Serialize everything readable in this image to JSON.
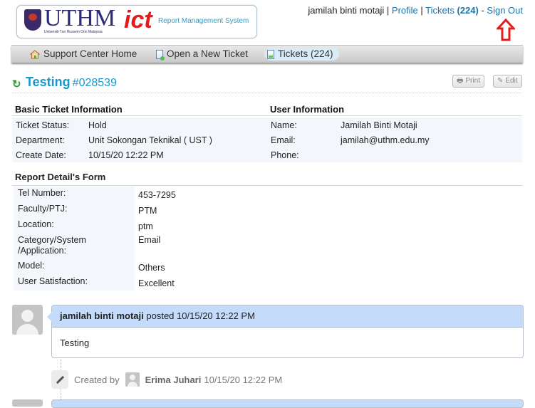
{
  "header": {
    "logo": {
      "brand": "UTHM",
      "brand_sub": "Universiti Tun Hussein Onn Malaysia",
      "ict": "ict",
      "system_name": "Report Management System"
    },
    "user_links": {
      "username": "jamilah binti motaji",
      "separator1": " | ",
      "profile": "Profile",
      "separator2": " | ",
      "tickets": "Tickets",
      "tickets_count": "(224)",
      "separator3": " - ",
      "sign_out": "Sign Out"
    },
    "annotation_arrow_color": "#e31d1d"
  },
  "nav": {
    "items": [
      {
        "label": "Support Center Home",
        "icon": "home-icon",
        "active": false
      },
      {
        "label": "Open a New Ticket",
        "icon": "new-ticket-icon",
        "active": false
      },
      {
        "label": "Tickets (224)",
        "icon": "tickets-icon",
        "active": true
      }
    ]
  },
  "ticket": {
    "title": "Testing",
    "number": "#028539",
    "status_icon": "refresh-icon",
    "actions": {
      "print": "Print",
      "edit": "Edit"
    }
  },
  "basic_info": {
    "heading": "Basic Ticket Information",
    "rows": [
      {
        "label": "Ticket Status:",
        "value": "Hold"
      },
      {
        "label": "Department:",
        "value": "Unit Sokongan Teknikal ( UST )"
      },
      {
        "label": "Create Date:",
        "value": "10/15/20 12:22 PM"
      }
    ]
  },
  "user_info": {
    "heading": "User Information",
    "rows": [
      {
        "label": "Name:",
        "value": "Jamilah Binti Motaji"
      },
      {
        "label": "Email:",
        "value": "jamilah@uthm.edu.my"
      },
      {
        "label": "Phone:",
        "value": ""
      }
    ]
  },
  "report_form": {
    "heading": "Report Detail's Form",
    "rows": [
      {
        "label": "Tel Number:",
        "value": "453-7295"
      },
      {
        "label": "Faculty/PTJ:",
        "value": "PTM"
      },
      {
        "label": "Location:",
        "value": "ptm"
      },
      {
        "label": "Category/System /Application:",
        "value": "Email"
      },
      {
        "label": "Model:",
        "value": "Others"
      },
      {
        "label": "User Satisfaction:",
        "value": "Excellent"
      }
    ]
  },
  "thread": {
    "entries": [
      {
        "author": "jamilah binti motaji",
        "verb": "posted",
        "timestamp": "10/15/20 12:22 PM",
        "body": "Testing"
      }
    ],
    "events": [
      {
        "prefix": "Created by",
        "user": "Erima Juhari",
        "timestamp": "10/15/20 12:22 PM"
      }
    ]
  },
  "colors": {
    "link": "#1e73a8",
    "title": "#1996cc",
    "thread_header": "#c4dbfb",
    "info_bg": "#f3f7fc"
  }
}
